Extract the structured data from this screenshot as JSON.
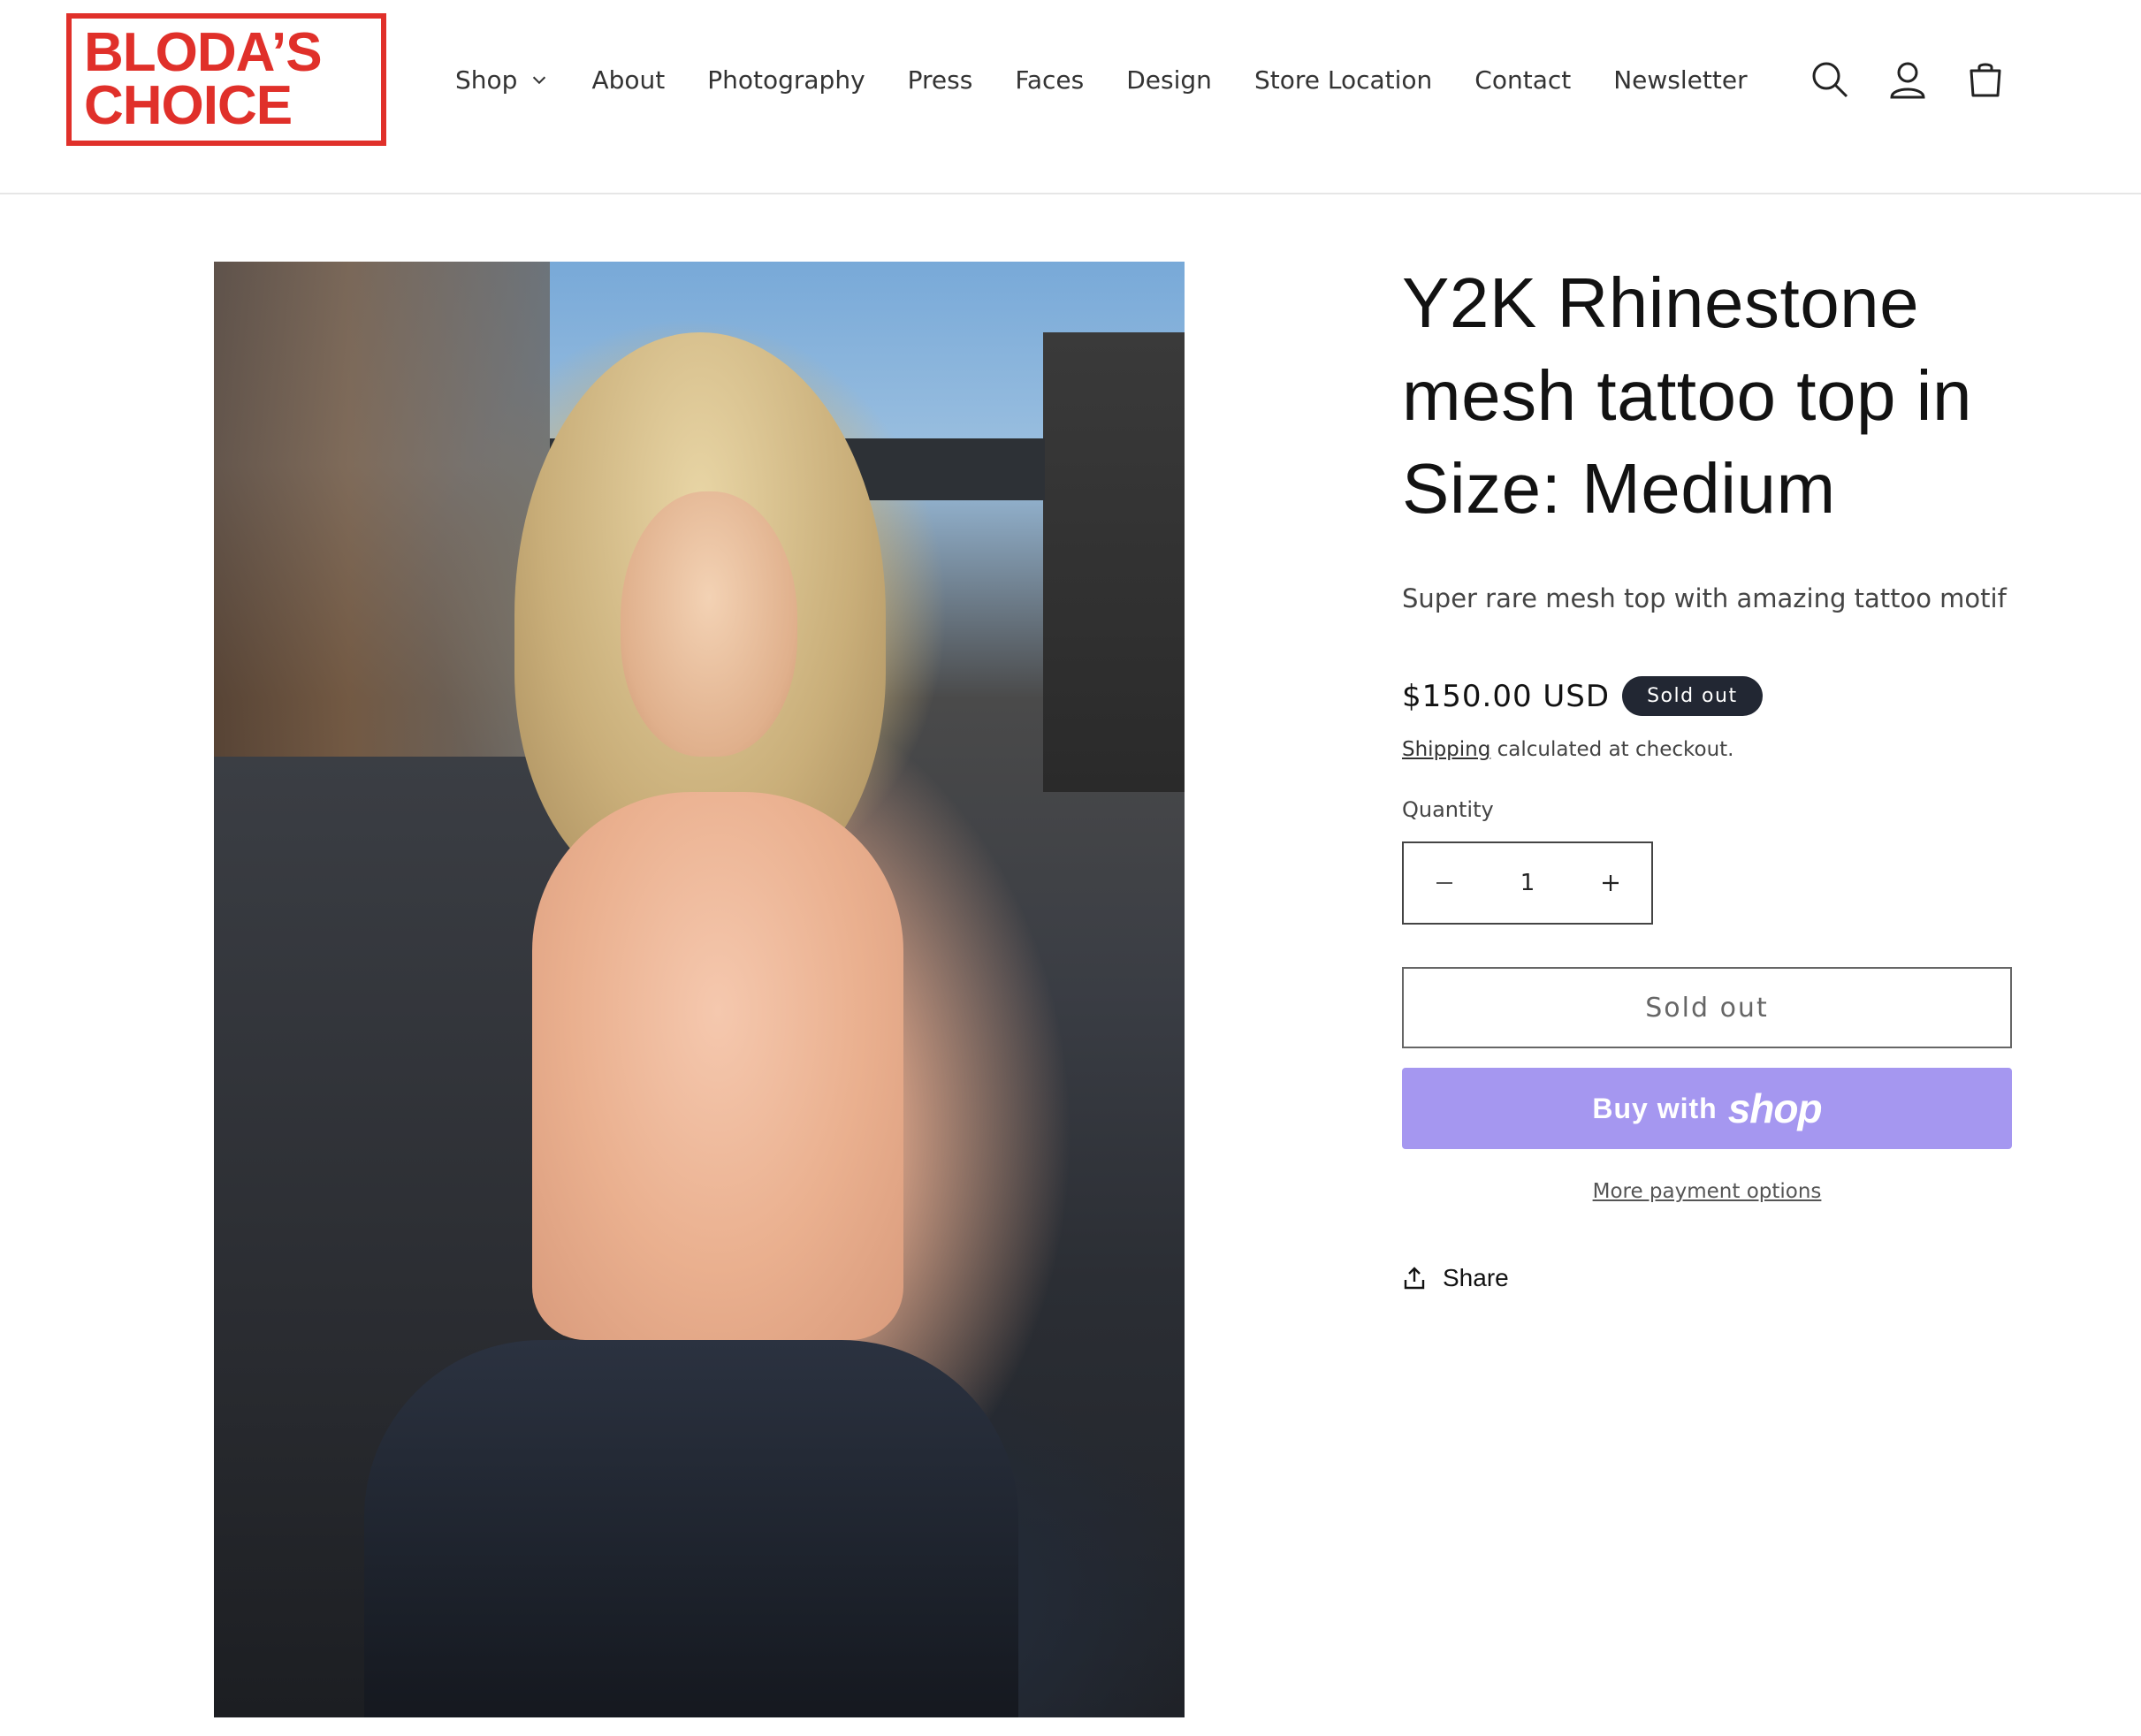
{
  "header": {
    "logo": {
      "line1": "BLODA’S",
      "line2": "CHOICE"
    },
    "nav": [
      {
        "label": "Shop",
        "has_dropdown": true
      },
      {
        "label": "About"
      },
      {
        "label": "Photography"
      },
      {
        "label": "Press"
      },
      {
        "label": "Faces"
      },
      {
        "label": "Design"
      },
      {
        "label": "Store Location"
      },
      {
        "label": "Contact"
      },
      {
        "label": "Newsletter"
      }
    ],
    "icons": [
      "search-icon",
      "account-icon",
      "cart-icon"
    ]
  },
  "product": {
    "title": "Y2K Rhinestone mesh tattoo top in Size: Medium",
    "description": "Super rare mesh top with amazing tattoo motif",
    "price": "$150.00 USD",
    "badge": "Sold out",
    "shipping_link": "Shipping",
    "shipping_text": " calculated at checkout.",
    "quantity_label": "Quantity",
    "quantity_value": "1",
    "sold_out_button": "Sold out",
    "buy_with": "Buy with",
    "shop_logo": "shop",
    "more_payment": "More payment options",
    "share": "Share"
  },
  "colors": {
    "brand": "#e0302a",
    "shop_pay": "#a597f0",
    "badge_bg": "#222733"
  }
}
